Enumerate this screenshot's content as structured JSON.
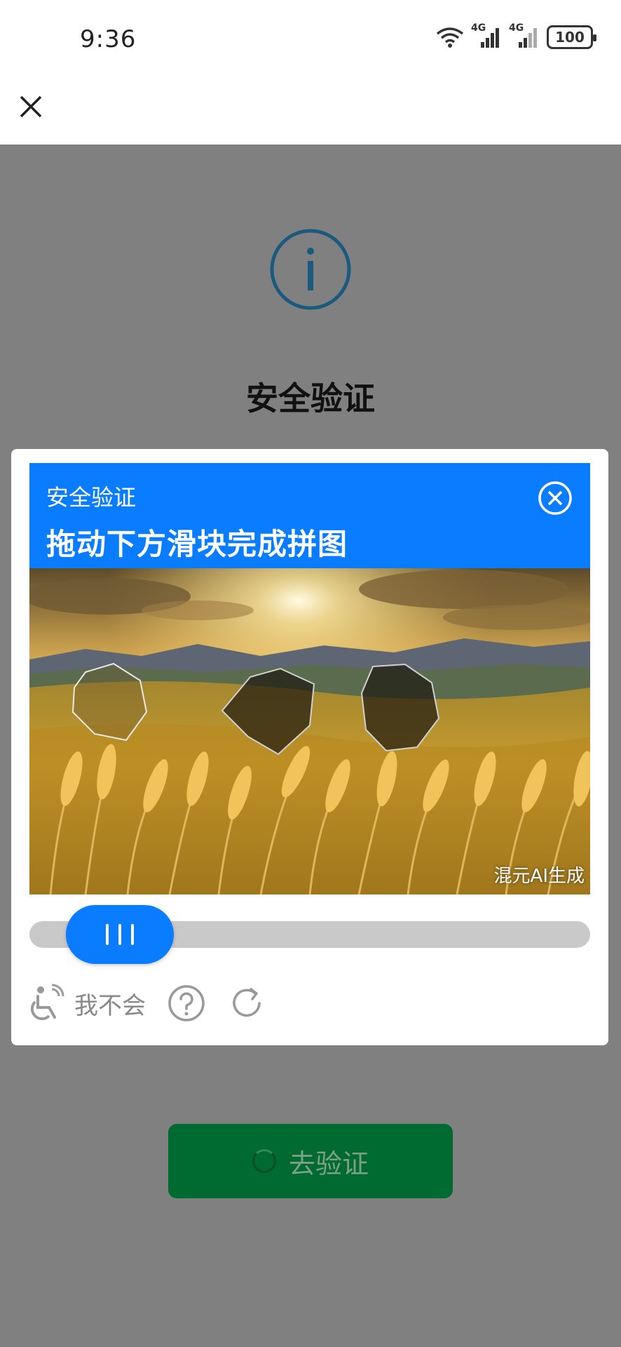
{
  "status_bar": {
    "time": "9:36",
    "network1": "4G",
    "network2": "4G",
    "battery": "100"
  },
  "header": {
    "close_icon": "close-icon"
  },
  "page": {
    "info_icon": "info-circle-icon",
    "title": "安全验证",
    "verify_button": "去验证"
  },
  "captcha": {
    "subtitle": "安全验证",
    "title": "拖动下方滑块完成拼图",
    "watermark": "混元AI生成",
    "accessibility_label": "我不会",
    "colors": {
      "accent": "#0a7cff",
      "verify_button": "#006b30",
      "overlay": "#808080"
    }
  }
}
